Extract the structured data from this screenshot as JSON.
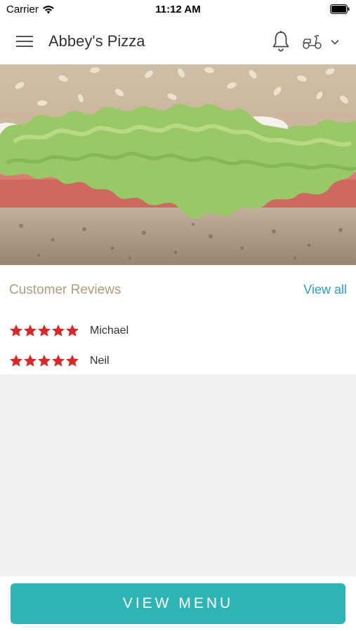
{
  "status_bar": {
    "carrier": "Carrier",
    "time": "11:12 AM"
  },
  "header": {
    "title": "Abbey's Pizza"
  },
  "reviews": {
    "title": "Customer Reviews",
    "view_all": "View all",
    "items": [
      {
        "name": "Michael",
        "rating": 5
      },
      {
        "name": "Neil",
        "rating": 5
      }
    ]
  },
  "footer": {
    "view_menu_label": "VIEW MENU"
  },
  "icons": {
    "menu": "hamburger-menu-icon",
    "notifications": "bell-icon",
    "order_mode": "scooter-icon",
    "dropdown": "chevron-down-icon",
    "rating": "star-icon"
  },
  "colors": {
    "accent": "#2fb4b6",
    "link": "#2a9fd0",
    "section_title": "#ad9e7f",
    "star": "#d62a2a",
    "background_gray": "#f1f1f1"
  }
}
